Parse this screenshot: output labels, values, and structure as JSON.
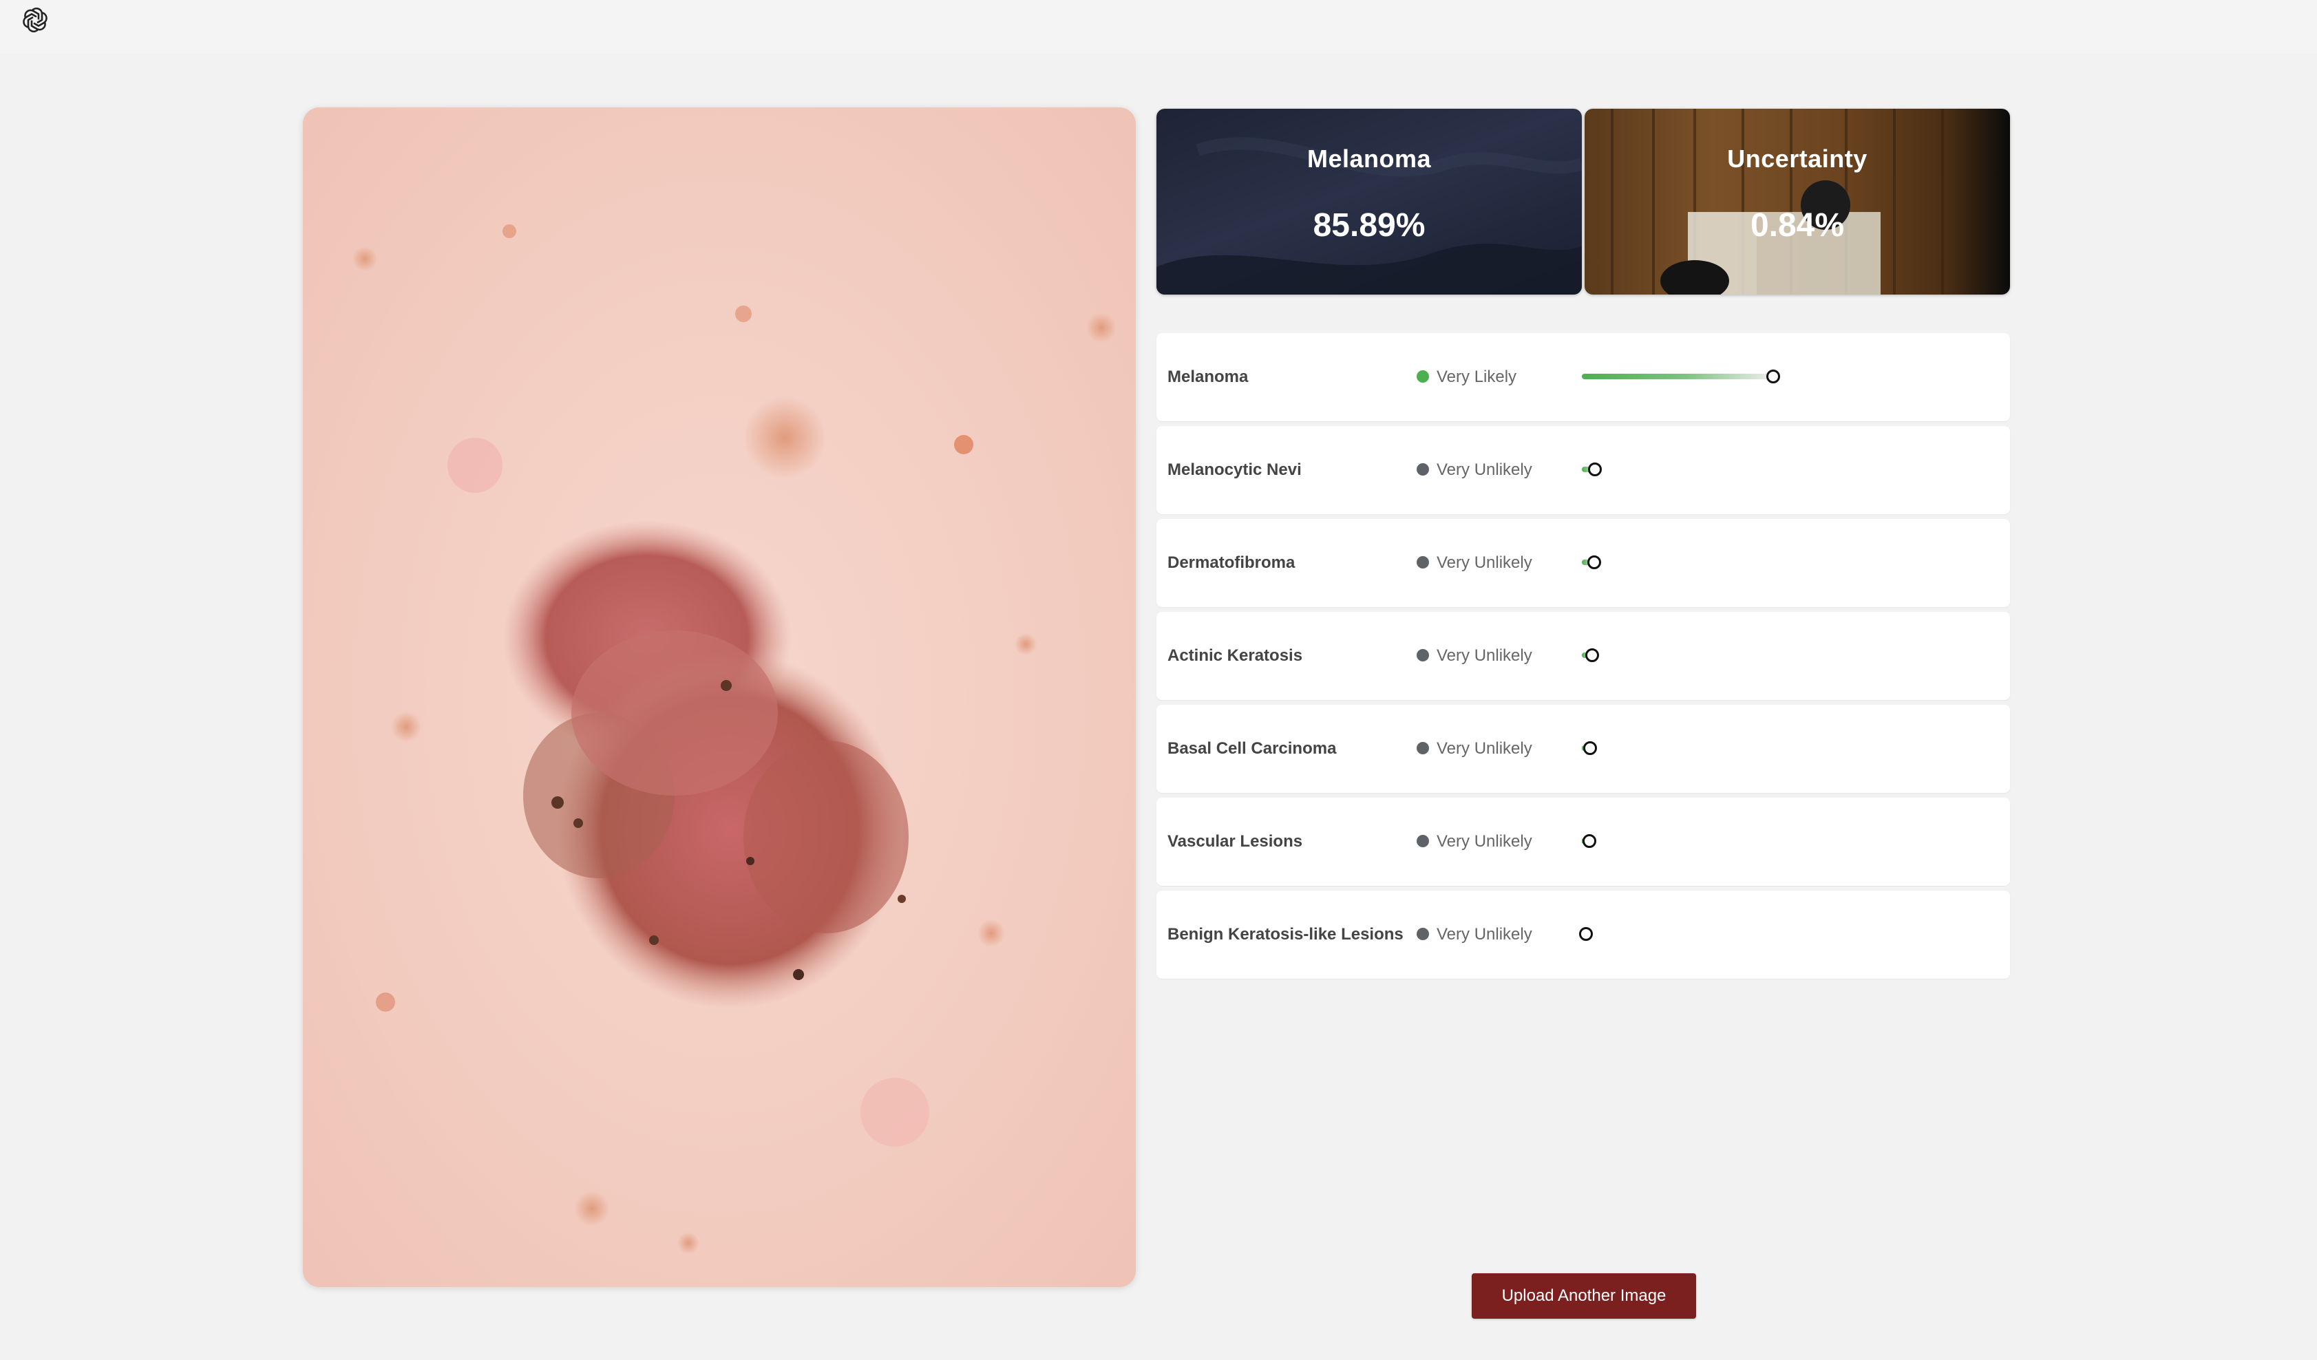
{
  "app": {
    "logo_icon": "openai-logo-icon"
  },
  "image": {
    "alt": "skin-lesion-photo"
  },
  "summary": {
    "prediction": {
      "title": "Melanoma",
      "value": "85.89%"
    },
    "uncertainty": {
      "title": "Uncertainty",
      "value": "0.84%"
    }
  },
  "results": [
    {
      "label": "Melanoma",
      "status": "Very Likely",
      "status_color": "#4caf50",
      "probability": 0.8589
    },
    {
      "label": "Melanocytic Nevi",
      "status": "Very Unlikely",
      "status_color": "#5f6368",
      "probability": 0.03
    },
    {
      "label": "Dermatofibroma",
      "status": "Very Unlikely",
      "status_color": "#5f6368",
      "probability": 0.025
    },
    {
      "label": "Actinic Keratosis",
      "status": "Very Unlikely",
      "status_color": "#5f6368",
      "probability": 0.015
    },
    {
      "label": "Basal Cell Carcinoma",
      "status": "Very Unlikely",
      "status_color": "#5f6368",
      "probability": 0.005
    },
    {
      "label": "Vascular Lesions",
      "status": "Very Unlikely",
      "status_color": "#5f6368",
      "probability": 0.002
    },
    {
      "label": "Benign Keratosis-like Lesions",
      "status": "Very Unlikely",
      "status_color": "#5f6368",
      "probability": 0.0
    }
  ],
  "actions": {
    "upload_label": "Upload Another Image"
  },
  "colors": {
    "accent": "#7b1f1f",
    "positive": "#4caf50",
    "neutral": "#5f6368"
  }
}
